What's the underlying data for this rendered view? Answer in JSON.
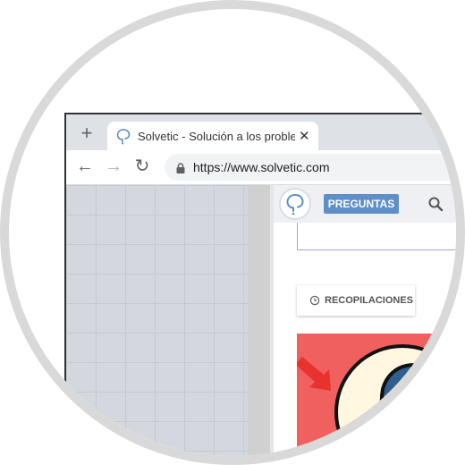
{
  "browser": {
    "tab": {
      "title": "Solvetic - Solución a los problem",
      "close_glyph": "✕",
      "favicon": "solvetic-logo-icon"
    },
    "newtab_glyph": "+",
    "toolbar": {
      "back_glyph": "←",
      "forward_glyph": "→",
      "reload_glyph": "↻",
      "url": "https://www.solvetic.com"
    }
  },
  "site": {
    "nav": {
      "preguntas_label": "PREGUNTAS"
    },
    "recopilaciones_label": "RECOPILACIONES",
    "colors": {
      "accent": "#5e8fc8",
      "hero_bg": "#f0605f"
    }
  }
}
